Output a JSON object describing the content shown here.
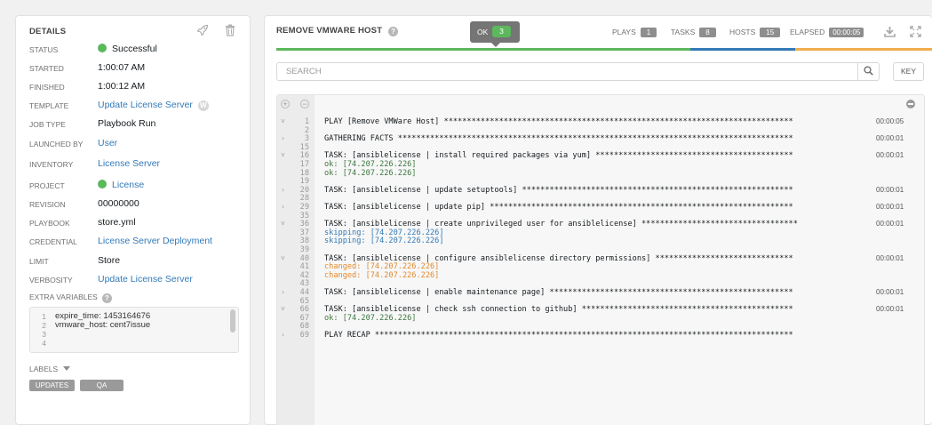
{
  "details": {
    "title": "DETAILS",
    "rows": [
      {
        "label": "STATUS",
        "value": "Successful",
        "link": false
      },
      {
        "label": "STARTED",
        "value": "1:00:07 AM",
        "link": false
      },
      {
        "label": "FINISHED",
        "value": "1:00:12 AM",
        "link": false
      },
      {
        "label": "TEMPLATE",
        "value": "Update License Server",
        "link": true
      },
      {
        "label": "JOB TYPE",
        "value": "Playbook Run",
        "link": false
      },
      {
        "label": "LAUNCHED BY",
        "value": "User",
        "link": true
      },
      {
        "label": "INVENTORY",
        "value": "License Server",
        "link": true
      },
      {
        "label": "PROJECT",
        "value": "License",
        "link": true
      },
      {
        "label": "REVISION",
        "value": "00000000",
        "link": false
      },
      {
        "label": "PLAYBOOK",
        "value": "store.yml",
        "link": false
      },
      {
        "label": "CREDENTIAL",
        "value": "License Server Deployment",
        "link": true
      },
      {
        "label": "LIMIT",
        "value": "Store",
        "link": false
      },
      {
        "label": "VERBOSITY",
        "value": "Update License Server",
        "link": true
      }
    ],
    "template_badge": "W",
    "extra_variables_label": "EXTRA VARIABLES",
    "extra_variables_help": "?",
    "extra_variables": [
      {
        "num": "1",
        "text": "expire_time: 1453164676"
      },
      {
        "num": "2",
        "text": "vmware_host: cent7issue"
      },
      {
        "num": "3",
        "text": ""
      },
      {
        "num": "4",
        "text": ""
      }
    ],
    "labels_label": "LABELS",
    "labels": [
      "UPDATES",
      "QA"
    ]
  },
  "output": {
    "title": "REMOVE VMWARE HOST",
    "help": "?",
    "tooltip": {
      "label": "OK",
      "count": "3"
    },
    "stats": [
      {
        "label": "PLAYS",
        "value": "1"
      },
      {
        "label": "TASKS",
        "value": "8"
      },
      {
        "label": "HOSTS",
        "value": "15"
      },
      {
        "label": "ELAPSED",
        "value": "00:00:05"
      }
    ],
    "progress": [
      {
        "status": "ok",
        "fraction": 0.63,
        "color": "#5cb85c"
      },
      {
        "status": "skipped",
        "fraction": 0.16,
        "color": "#337ab7"
      },
      {
        "status": "changed",
        "fraction": 0.21,
        "color": "#f0ad4e"
      }
    ],
    "search": {
      "placeholder": "SEARCH",
      "value": ""
    },
    "key_label": "KEY",
    "console": {
      "expand_all": "+",
      "collapse_all": "−",
      "lines": [
        {
          "num": "1",
          "toggle": "˅",
          "style": "",
          "text": "PLAY [Remove VMWare Host] ****************************************************************************",
          "dur": "00:00:05"
        },
        {
          "num": "2",
          "toggle": "",
          "style": "",
          "text": "",
          "dur": ""
        },
        {
          "num": "3",
          "toggle": "›",
          "style": "",
          "text": "GATHERING FACTS **************************************************************************************",
          "dur": "00:00:01"
        },
        {
          "num": "15",
          "toggle": "",
          "style": "",
          "text": "",
          "dur": ""
        },
        {
          "num": "16",
          "toggle": "˅",
          "style": "",
          "text": "TASK: [ansiblelicense | install required packages via yum] *******************************************",
          "dur": "00:00:01"
        },
        {
          "num": "17",
          "toggle": "",
          "style": "ok",
          "text": "ok: [74.207.226.226]",
          "dur": ""
        },
        {
          "num": "18",
          "toggle": "",
          "style": "ok",
          "text": "ok: [74.207.226.226]",
          "dur": ""
        },
        {
          "num": "19",
          "toggle": "",
          "style": "",
          "text": "",
          "dur": ""
        },
        {
          "num": "20",
          "toggle": "›",
          "style": "",
          "text": "TASK: [ansiblelicense | update setuptools] ***********************************************************",
          "dur": "00:00:01"
        },
        {
          "num": "28",
          "toggle": "",
          "style": "",
          "text": "",
          "dur": ""
        },
        {
          "num": "29",
          "toggle": "›",
          "style": "",
          "text": "TASK: [ansiblelicense | update pip] ******************************************************************",
          "dur": "00:00:01"
        },
        {
          "num": "35",
          "toggle": "",
          "style": "",
          "text": "",
          "dur": ""
        },
        {
          "num": "36",
          "toggle": "˅",
          "style": "",
          "text": "TASK: [ansiblelicense | create unprivileged user for ansiblelicense] **********************************",
          "dur": "00:00:01"
        },
        {
          "num": "37",
          "toggle": "",
          "style": "skip",
          "text": "skipping: [74.207.226.226]",
          "dur": ""
        },
        {
          "num": "38",
          "toggle": "",
          "style": "skip",
          "text": "skipping: [74.207.226.226]",
          "dur": ""
        },
        {
          "num": "39",
          "toggle": "",
          "style": "",
          "text": "",
          "dur": ""
        },
        {
          "num": "40",
          "toggle": "˅",
          "style": "",
          "text": "TASK: [ansiblelicense | configure ansiblelicense directory permissions] ******************************",
          "dur": "00:00:01"
        },
        {
          "num": "41",
          "toggle": "",
          "style": "changed",
          "text": "changed: [74.207.226.226]",
          "dur": ""
        },
        {
          "num": "42",
          "toggle": "",
          "style": "changed",
          "text": "changed: [74.207.226.226]",
          "dur": ""
        },
        {
          "num": "43",
          "toggle": "",
          "style": "",
          "text": "",
          "dur": ""
        },
        {
          "num": "44",
          "toggle": "›",
          "style": "",
          "text": "TASK: [ansiblelicense | enable maintenance page] *****************************************************",
          "dur": "00:00:01"
        },
        {
          "num": "65",
          "toggle": "",
          "style": "",
          "text": "",
          "dur": ""
        },
        {
          "num": "66",
          "toggle": "˅",
          "style": "",
          "text": "TASK: [ansiblelicense | check ssh connection to github] **********************************************",
          "dur": "00:00:01"
        },
        {
          "num": "67",
          "toggle": "",
          "style": "ok",
          "text": "ok: [74.207.226.226]",
          "dur": ""
        },
        {
          "num": "68",
          "toggle": "",
          "style": "",
          "text": "",
          "dur": ""
        },
        {
          "num": "69",
          "toggle": "›",
          "style": "",
          "text": "PLAY RECAP *******************************************************************************************",
          "dur": ""
        }
      ]
    }
  },
  "icons": {
    "launch": "rocket-icon",
    "delete": "trash-icon",
    "download": "download-icon",
    "fullscreen": "expand-icon",
    "search": "search-icon",
    "console_menu": "collapse-icon"
  },
  "colors": {
    "success": "#5cb85c",
    "link": "#337ab7",
    "skipped": "#337ab7",
    "changed": "#f0ad4e",
    "badge": "#8e8e8e"
  }
}
